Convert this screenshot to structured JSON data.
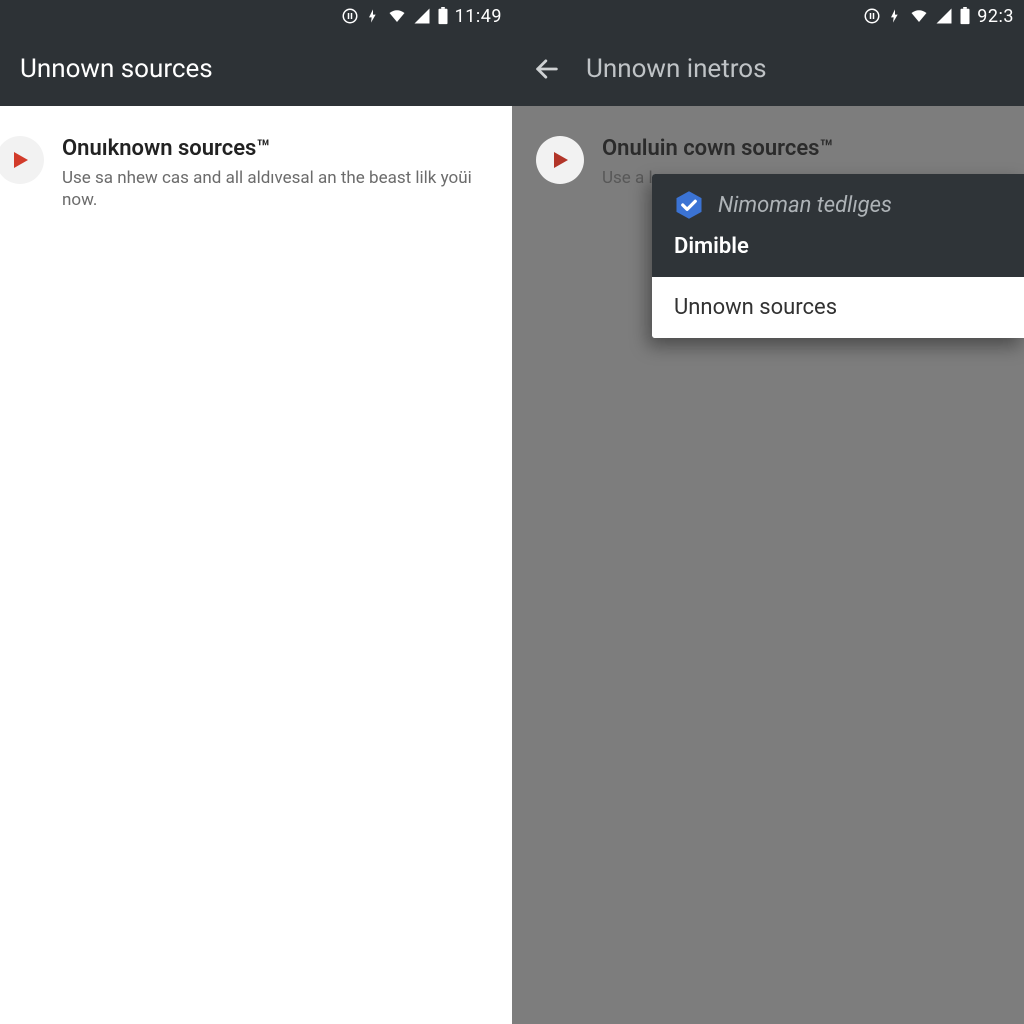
{
  "left": {
    "status": {
      "time": "11:49"
    },
    "appbar": {
      "title": "Unnown sources"
    },
    "setting": {
      "title": "Onuıknown sources™",
      "subtitle": "Use sa nhew cas and all aldıvesal an the beast lilk yoüi now."
    }
  },
  "right": {
    "status": {
      "time": "92:3"
    },
    "appbar": {
      "title": "Unnown inetros"
    },
    "setting": {
      "title": "Onuluin cown sources™",
      "subtitle": "Use a low n"
    },
    "dialog": {
      "app": "Nimoman tedlıges",
      "action": "Dimible",
      "item": "Unnown sources"
    }
  }
}
